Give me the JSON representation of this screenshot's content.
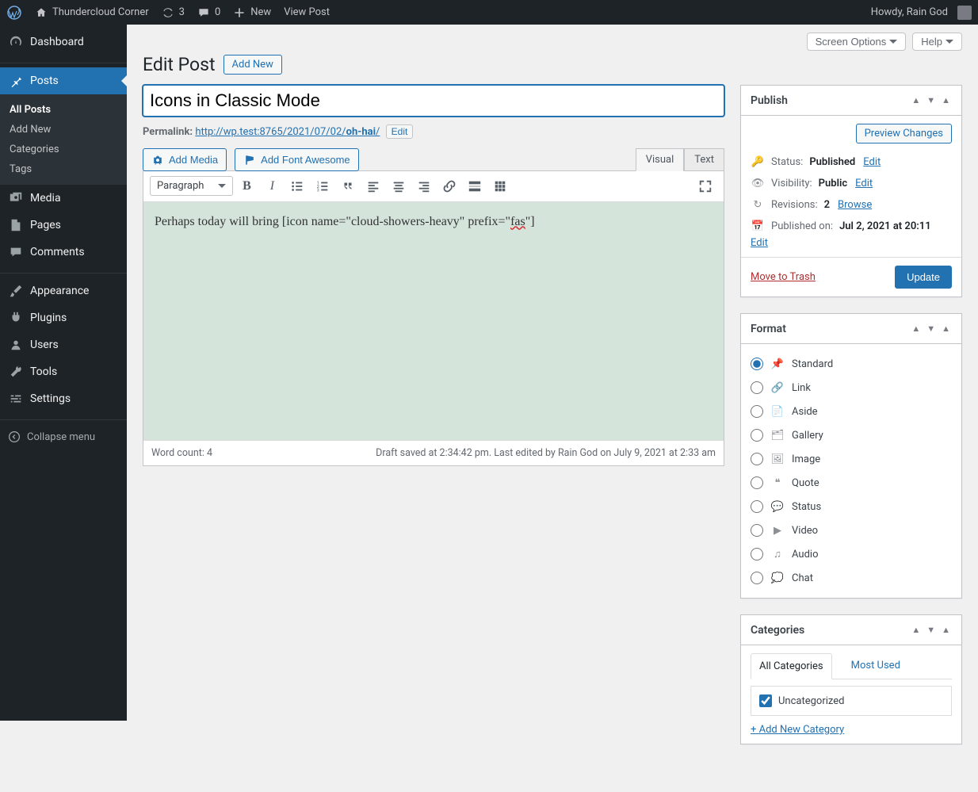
{
  "adminbar": {
    "site_name": "Thundercloud Corner",
    "updates": "3",
    "comments": "0",
    "new": "New",
    "view_post": "View Post",
    "howdy": "Howdy, Rain God"
  },
  "sidebar": {
    "items": [
      {
        "key": "dashboard",
        "label": "Dashboard"
      },
      {
        "key": "posts",
        "label": "Posts"
      },
      {
        "key": "media",
        "label": "Media"
      },
      {
        "key": "pages",
        "label": "Pages"
      },
      {
        "key": "comments",
        "label": "Comments"
      },
      {
        "key": "appearance",
        "label": "Appearance"
      },
      {
        "key": "plugins",
        "label": "Plugins"
      },
      {
        "key": "users",
        "label": "Users"
      },
      {
        "key": "tools",
        "label": "Tools"
      },
      {
        "key": "settings",
        "label": "Settings"
      }
    ],
    "submenu": [
      "All Posts",
      "Add New",
      "Categories",
      "Tags"
    ],
    "collapse": "Collapse menu"
  },
  "screenmeta": {
    "screen_options": "Screen Options",
    "help": "Help"
  },
  "header": {
    "title": "Edit Post",
    "add_new": "Add New"
  },
  "title_value": "Icons in Classic Mode",
  "permalink": {
    "label": "Permalink:",
    "base": "http://wp.test:8765/2021/07/02/",
    "slug": "oh-hai",
    "slash": "/",
    "edit": "Edit"
  },
  "buttons": {
    "add_media": "Add Media",
    "add_fa": "Add Font Awesome"
  },
  "tabs": {
    "visual": "Visual",
    "text": "Text"
  },
  "toolbar": {
    "format": "Paragraph"
  },
  "editor": {
    "before": "Perhaps today will bring [icon name=\"cloud-showers-heavy\" prefix=\"",
    "mark": "fas",
    "after": "\"]"
  },
  "statusbar": {
    "wordcount": "Word count: 4",
    "draftinfo": "Draft saved at 2:34:42 pm. Last edited by Rain God on July 9, 2021 at 2:33 am"
  },
  "publish": {
    "heading": "Publish",
    "preview": "Preview Changes",
    "status_label": "Status:",
    "status_value": "Published",
    "visibility_label": "Visibility:",
    "visibility_value": "Public",
    "revisions_label": "Revisions:",
    "revisions_value": "2",
    "browse": "Browse",
    "published_label": "Published on:",
    "published_value": "Jul 2, 2021 at 20:11",
    "edit": "Edit",
    "trash": "Move to Trash",
    "update": "Update"
  },
  "format": {
    "heading": "Format",
    "options": [
      "Standard",
      "Link",
      "Aside",
      "Gallery",
      "Image",
      "Quote",
      "Status",
      "Video",
      "Audio",
      "Chat"
    ],
    "selected": "Standard"
  },
  "categories": {
    "heading": "Categories",
    "tabs": [
      "All Categories",
      "Most Used"
    ],
    "items": [
      "Uncategorized"
    ],
    "add_new": "+ Add New Category"
  }
}
